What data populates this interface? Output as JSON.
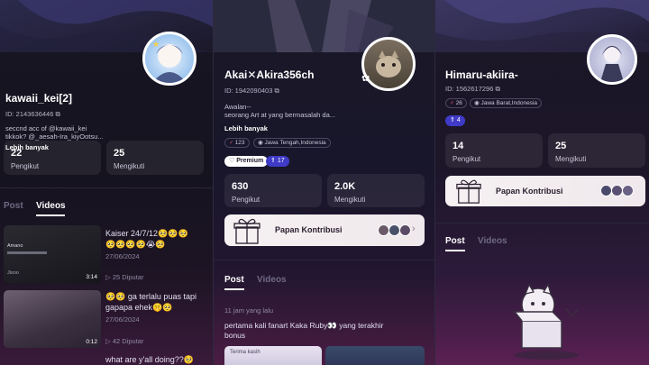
{
  "profiles": [
    {
      "username": "kawaii_kei[2]",
      "id": "ID: 2143636446",
      "bio": [
        "seccnd acc of @kawaii_kei",
        "tikkok? @_aesah-Ira_kiyOotsu..."
      ],
      "more_label": "Lebih banyak",
      "stats": [
        {
          "value": "22",
          "label": "Pengikut"
        },
        {
          "value": "25",
          "label": "Mengikuti"
        }
      ],
      "tabs": [
        {
          "label": "Post"
        },
        {
          "label": "Videos"
        }
      ],
      "videos": [
        {
          "title": "Kaiser 24/7/12🥺🥺🥺",
          "emoji_line": "🥺🥺🥺🥺😭🥺",
          "date": "27/06/2024",
          "duration": "3:14",
          "views": "25 Diputar",
          "thumb_title": "Amano",
          "thumb_label": "Jisoo"
        },
        {
          "title": "🥺🥺 ga terlalu puas tapi",
          "emoji_line": "gapapa ehek🤫🥺",
          "date": "27/06/2024",
          "duration": "0:12",
          "views": "42 Diputar"
        },
        {
          "title": "what are y'all doing??🥺"
        }
      ]
    },
    {
      "username": "Akai✕Akira356ch",
      "id": "ID: 1942090403",
      "bio": [
        "Awalan--",
        "seorang Art at yang bermasalah da..."
      ],
      "more_label": "Lebih banyak",
      "chips": [
        {
          "text": "123",
          "glyph": "♂"
        },
        {
          "text": "Jawa Tengah,Indonesia",
          "glyph": "◉"
        }
      ],
      "badges": [
        {
          "text": "Premium"
        },
        {
          "text": "17"
        }
      ],
      "stats": [
        {
          "value": "630",
          "label": "Pengikut"
        },
        {
          "value": "2.0K",
          "label": "Mengikuti"
        }
      ],
      "papan_label": "Papan Kontribusi",
      "tabs": [
        {
          "label": "Post"
        },
        {
          "label": "Videos"
        }
      ],
      "post": {
        "time": "11 jam yang lalu",
        "text": [
          "pertama kali fanart Kaka Ruby👀 yang terakhir",
          "bonus"
        ],
        "thumb_caption": "Terima kasih"
      }
    },
    {
      "username": "Himaru-akiira-",
      "id": "ID: 1562617296",
      "chips": [
        {
          "text": "26",
          "glyph": "♂"
        },
        {
          "text": "Jawa Barat,Indonesia",
          "glyph": "◉"
        }
      ],
      "badges": [
        {
          "text": "4"
        }
      ],
      "stats": [
        {
          "value": "14",
          "label": "Pengikut"
        },
        {
          "value": "25",
          "label": "Mengikuti"
        }
      ],
      "papan_label": "Papan Kontribusi",
      "tabs": [
        {
          "label": "Post"
        },
        {
          "label": "Videos"
        }
      ]
    }
  ],
  "colors": {
    "accent": "#5b3ad8",
    "premium": "#ffffff",
    "level": "#4a40d8",
    "gender": "#ff5a86"
  }
}
